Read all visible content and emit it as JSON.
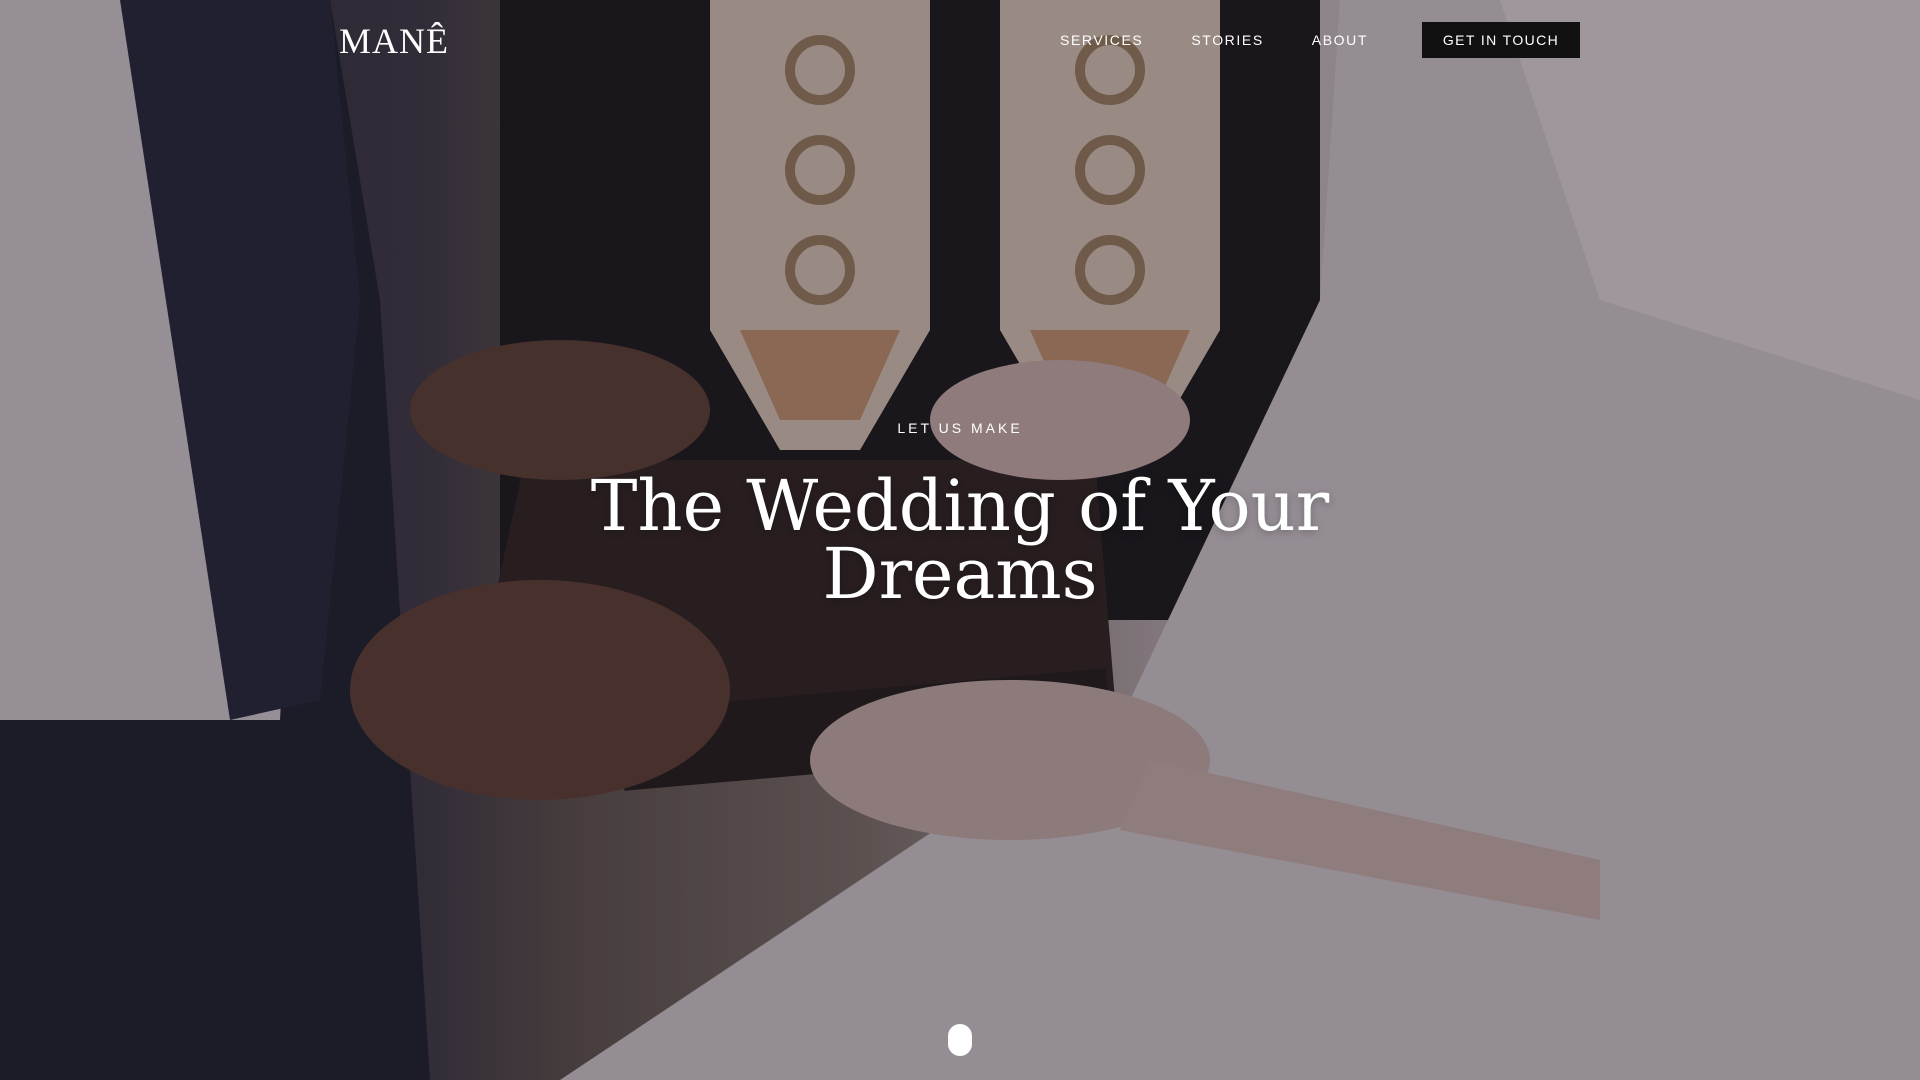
{
  "header": {
    "logo_text": "MANÊ",
    "nav": [
      {
        "label": "SERVICES"
      },
      {
        "label": "STORIES"
      },
      {
        "label": "ABOUT"
      }
    ],
    "cta_label": "GET IN TOUCH"
  },
  "hero": {
    "eyebrow": "LET US MAKE",
    "headline_line1": "The Wedding of Your",
    "headline_line2": "Dreams",
    "background_description_icon": "wedding-ceremony-photo",
    "scroll_icon": "scroll-indicator-icon"
  },
  "colors": {
    "cta_background": "#111111",
    "text": "#ffffff"
  }
}
